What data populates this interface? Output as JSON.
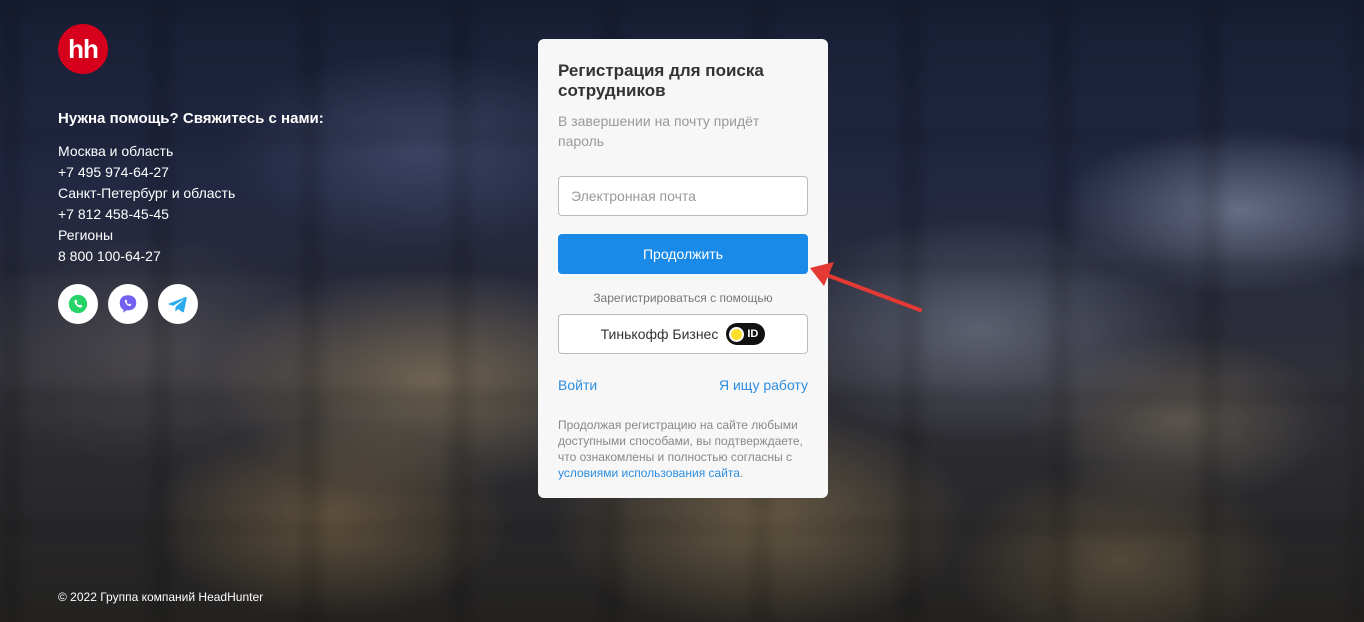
{
  "sidebar": {
    "logo_text": "hh",
    "help_title": "Нужна помощь? Свяжитесь с нами:",
    "contacts": [
      "Москва и область",
      "+7 495 974-64-27",
      "Санкт-Петербург и область",
      "+7 812 458-45-45",
      "Регионы",
      "8 800 100-64-27"
    ],
    "messengers": [
      "whatsapp-icon",
      "viber-icon",
      "telegram-icon"
    ],
    "footer": "© 2022 Группа компаний HeadHunter"
  },
  "card": {
    "title": "Регистрация для поиска сотрудников",
    "subtitle": "В завершении на почту придёт пароль",
    "email_placeholder": "Электронная почта",
    "email_value": "",
    "continue_label": "Продолжить",
    "register_with": "Зарегистрироваться с помощью",
    "tinkoff_label": "Тинькофф Бизнес",
    "tinkoff_badge": "ID",
    "login_link": "Войти",
    "job_seeker_link": "Я ищу работу",
    "legal_text": "Продолжая регистрацию на сайте любыми доступными способами, вы подтверждаете, что ознакомлены и полностью согласны с",
    "legal_link": "условиями использования сайта",
    "legal_end": "."
  },
  "colors": {
    "brand_red": "#d6001c",
    "primary_blue": "#1a8ae8",
    "link_blue": "#2d8ee0",
    "annotation_arrow": "#e53935"
  }
}
